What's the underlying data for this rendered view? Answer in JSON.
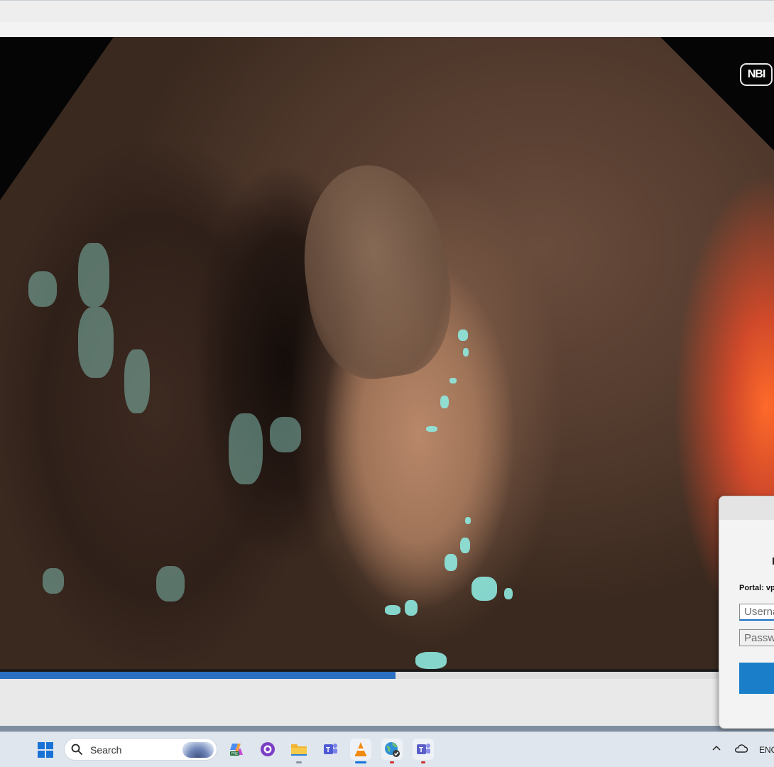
{
  "video": {
    "overlay_badge": "NBI",
    "progress_fraction": 0.511
  },
  "login": {
    "portal_label": "Portal: vp",
    "username_placeholder": "Userna",
    "password_placeholder": "Passwo"
  },
  "taskbar": {
    "search_label": "Search",
    "language": "ENG",
    "apps": [
      {
        "name": "copilot-icon",
        "color": "#8a5cf0"
      },
      {
        "name": "github-icon",
        "color": "#7b3fc4"
      },
      {
        "name": "file-explorer-icon",
        "color": "#f2b531"
      },
      {
        "name": "teams-icon",
        "color": "#4f5bd5"
      },
      {
        "name": "vlc-icon",
        "color": "#f08a10"
      },
      {
        "name": "browser-icon",
        "color": "#2f8fd6"
      },
      {
        "name": "teams-app-icon",
        "color": "#5b5fc7"
      }
    ]
  },
  "colors": {
    "accent": "#1a7ec8",
    "progress": "#2b6fc2",
    "taskbar": "#dfe6ee"
  }
}
